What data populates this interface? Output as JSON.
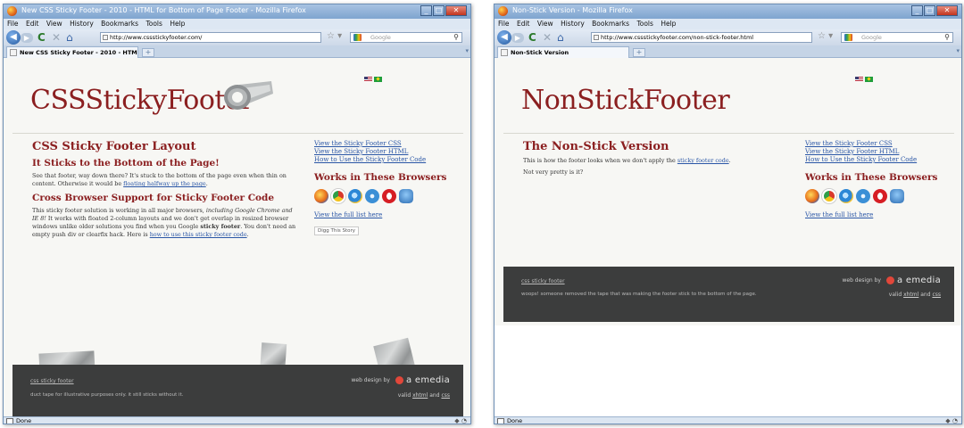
{
  "left": {
    "window_title": "New CSS Sticky Footer - 2010 - HTML for Bottom of Page Footer - Mozilla Firefox",
    "menu": [
      "File",
      "Edit",
      "View",
      "History",
      "Bookmarks",
      "Tools",
      "Help"
    ],
    "url": "http://www.cssstickyfooter.com/",
    "search_placeholder": "Google",
    "tab_label": "New CSS Sticky Footer - 2010 - HTM...",
    "logo": "CSSStickyFooter",
    "heading": "CSS Sticky Footer Layout",
    "subheading": "It Sticks to the Bottom of the Page!",
    "para1_a": "See that footer, way down there? It's stuck to the bottom of the page even when thin on content. Otherwise it would be ",
    "para1_link": "floating halfway up the page",
    "para1_b": ".",
    "heading2": "Cross Browser Support for Sticky Footer Code",
    "para2_a": "This sticky footer solution is working in all major browsers, ",
    "para2_i": "including Google Chrome and IE 8!",
    "para2_b": " It works with floated 2-column layouts and we don't get overlap in resized browser windows unlike older solutions you find when you Google ",
    "para2_bold": "sticky footer",
    "para2_c": ". You don't need an empty push div or clearfix hack. Here is ",
    "para2_link": "how to use this sticky footer code",
    "para2_d": ".",
    "side_links": [
      "View the Sticky Footer CSS",
      "View the Sticky Footer HTML",
      "How to Use the Sticky Footer Code"
    ],
    "browsers_heading": "Works in These Browsers",
    "full_list": "View the full list here",
    "digg": "Digg This Story",
    "footer_link": "css sticky footer",
    "footer_note": "duct tape for illustrative purposes only. it still sticks without it.",
    "web_design": "web design by",
    "brand": "a emedia",
    "valid": "valid",
    "xhtml": "xhtml",
    "and": "and",
    "css": "css",
    "status": "Done"
  },
  "right": {
    "window_title": "Non-Stick Version - Mozilla Firefox",
    "menu": [
      "File",
      "Edit",
      "View",
      "History",
      "Bookmarks",
      "Tools",
      "Help"
    ],
    "url": "http://www.cssstickyfooter.com/non-stick-footer.html",
    "search_placeholder": "Google",
    "tab_label": "Non-Stick Version",
    "logo": "NonStickFooter",
    "heading": "The Non-Stick Version",
    "para1_a": "This is how the footer looks when we don't apply the ",
    "para1_link": "sticky footer code",
    "para1_b": ".",
    "para2": "Not very pretty is it?",
    "side_links": [
      "View the Sticky Footer CSS",
      "View the Sticky Footer HTML",
      "How to Use the Sticky Footer Code"
    ],
    "browsers_heading": "Works in These Browsers",
    "full_list": "View the full list here",
    "footer_link": "css sticky footer",
    "footer_note": "woops! someone removed the tape that was making the footer stick to the bottom of the page.",
    "web_design": "web design by",
    "brand": "a emedia",
    "valid": "valid",
    "xhtml": "xhtml",
    "and": "and",
    "css": "css",
    "status": "Done"
  },
  "colors": {
    "heading_red": "#8b1f20",
    "link_blue": "#2a56a6",
    "footer_gray": "#3c3d3d",
    "brand_red": "#e1473a"
  },
  "icons": [
    "firefox-icon",
    "back-arrow-icon",
    "forward-arrow-icon",
    "reload-icon",
    "stop-icon",
    "home-icon",
    "bookmark-star-icon",
    "search-magnifier-icon",
    "duct-tape-roll-icon",
    "us-flag-icon",
    "brazil-flag-icon"
  ]
}
